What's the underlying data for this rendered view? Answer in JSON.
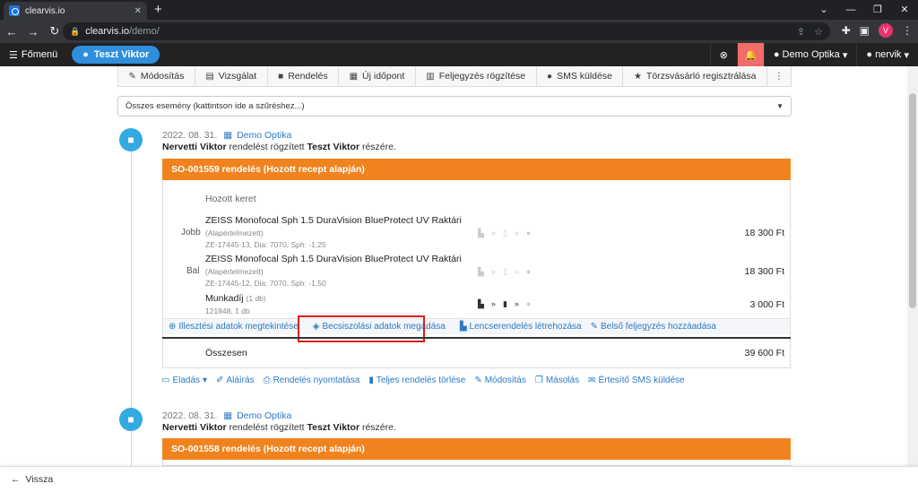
{
  "browser": {
    "tab_title": "clearvis.io",
    "tab_close": "✕",
    "new_tab": "+",
    "url_domain": "clearvis.io",
    "url_path": "/demo/",
    "profile_initial": "V"
  },
  "app": {
    "main_menu": "Főmenü",
    "user": "Teszt Viktor",
    "store": "Demo Optika",
    "account": "nervik"
  },
  "actions": [
    {
      "label": "Módosítás",
      "icon": "pencil-icon"
    },
    {
      "label": "Vizsgálat",
      "icon": "clipboard-icon"
    },
    {
      "label": "Rendelés",
      "icon": "shopping-bag-icon"
    },
    {
      "label": "Új időpont",
      "icon": "calendar-plus-icon"
    },
    {
      "label": "Feljegyzés rögzítése",
      "icon": "note-icon"
    },
    {
      "label": "SMS küldése",
      "icon": "chat-icon"
    },
    {
      "label": "Törzsvásárló regisztrálása",
      "icon": "star-icon"
    }
  ],
  "filter": {
    "text": "Összes esemény (kattintson ide a szűréshez...)"
  },
  "event1": {
    "date": "2022. 08. 31.",
    "location": "Demo Optika",
    "author": "Nervetti Viktor",
    "desc_mid": "rendelést rögzített",
    "customer": "Teszt Viktor",
    "desc_end": "részére.",
    "order_title": "SO-001559 rendelés (Hozott recept alapján)",
    "frame_label": "Hozott keret",
    "items": [
      {
        "side": "Jobb",
        "name": "ZEISS Monofocal Sph 1.5 DuraVision BlueProtect UV Raktári",
        "note": "(Alapértelmezett)",
        "sub": "ZE-17445-13, Dia: 7070, Sph: -1,25",
        "price": "18 300 Ft"
      },
      {
        "side": "Bal",
        "name": "ZEISS Monofocal Sph 1.5 DuraVision BlueProtect UV Raktári",
        "note": "(Alapértelmezett)",
        "sub": "ZE-17445-12, Dia: 7070, Sph: -1,50",
        "price": "18 300 Ft"
      },
      {
        "side": "",
        "name": "Munkadíj",
        "note": "(1 db)",
        "sub": "121848, 1 db",
        "price": "3 000 Ft"
      }
    ],
    "links": [
      {
        "label": "Illesztési adatok megtekintése",
        "icon": "fit-icon"
      },
      {
        "label": "Becsiszolási adatok megadása",
        "icon": "shield-icon"
      },
      {
        "label": "Lencserendelés létrehozása",
        "icon": "factory-icon"
      },
      {
        "label": "Belső feljegyzés hozzáadása",
        "icon": "edit-note-icon"
      }
    ],
    "total_label": "Összesen",
    "total_value": "39 600 Ft",
    "footer": [
      {
        "label": "Eladás",
        "icon": "cash-icon",
        "suffix": "▾"
      },
      {
        "label": "Aláírás",
        "icon": "brush-icon",
        "suffix": ""
      },
      {
        "label": "Rendelés nyomtatása",
        "icon": "print-icon",
        "suffix": ""
      },
      {
        "label": "Teljes rendelés törlése",
        "icon": "trash-icon",
        "suffix": ""
      },
      {
        "label": "Módosítás",
        "icon": "pencil-icon",
        "suffix": ""
      },
      {
        "label": "Másolás",
        "icon": "copy-icon",
        "suffix": ""
      },
      {
        "label": "Értesítő SMS küldése",
        "icon": "envelope-icon",
        "suffix": ""
      }
    ]
  },
  "event2": {
    "date": "2022. 08. 31.",
    "location": "Demo Optika",
    "author": "Nervetti Viktor",
    "desc_mid": "rendelést rögzített",
    "customer": "Teszt Viktor",
    "desc_end": "részére.",
    "order_title": "SO-001558 rendelés (Hozott recept alapján)"
  },
  "bottom": {
    "back": "Vissza"
  },
  "colors": {
    "accent_blue": "#2f8fdd",
    "order_orange": "#f0831e",
    "highlight_red": "#e01e1e",
    "bell_red": "#f26b6b"
  }
}
